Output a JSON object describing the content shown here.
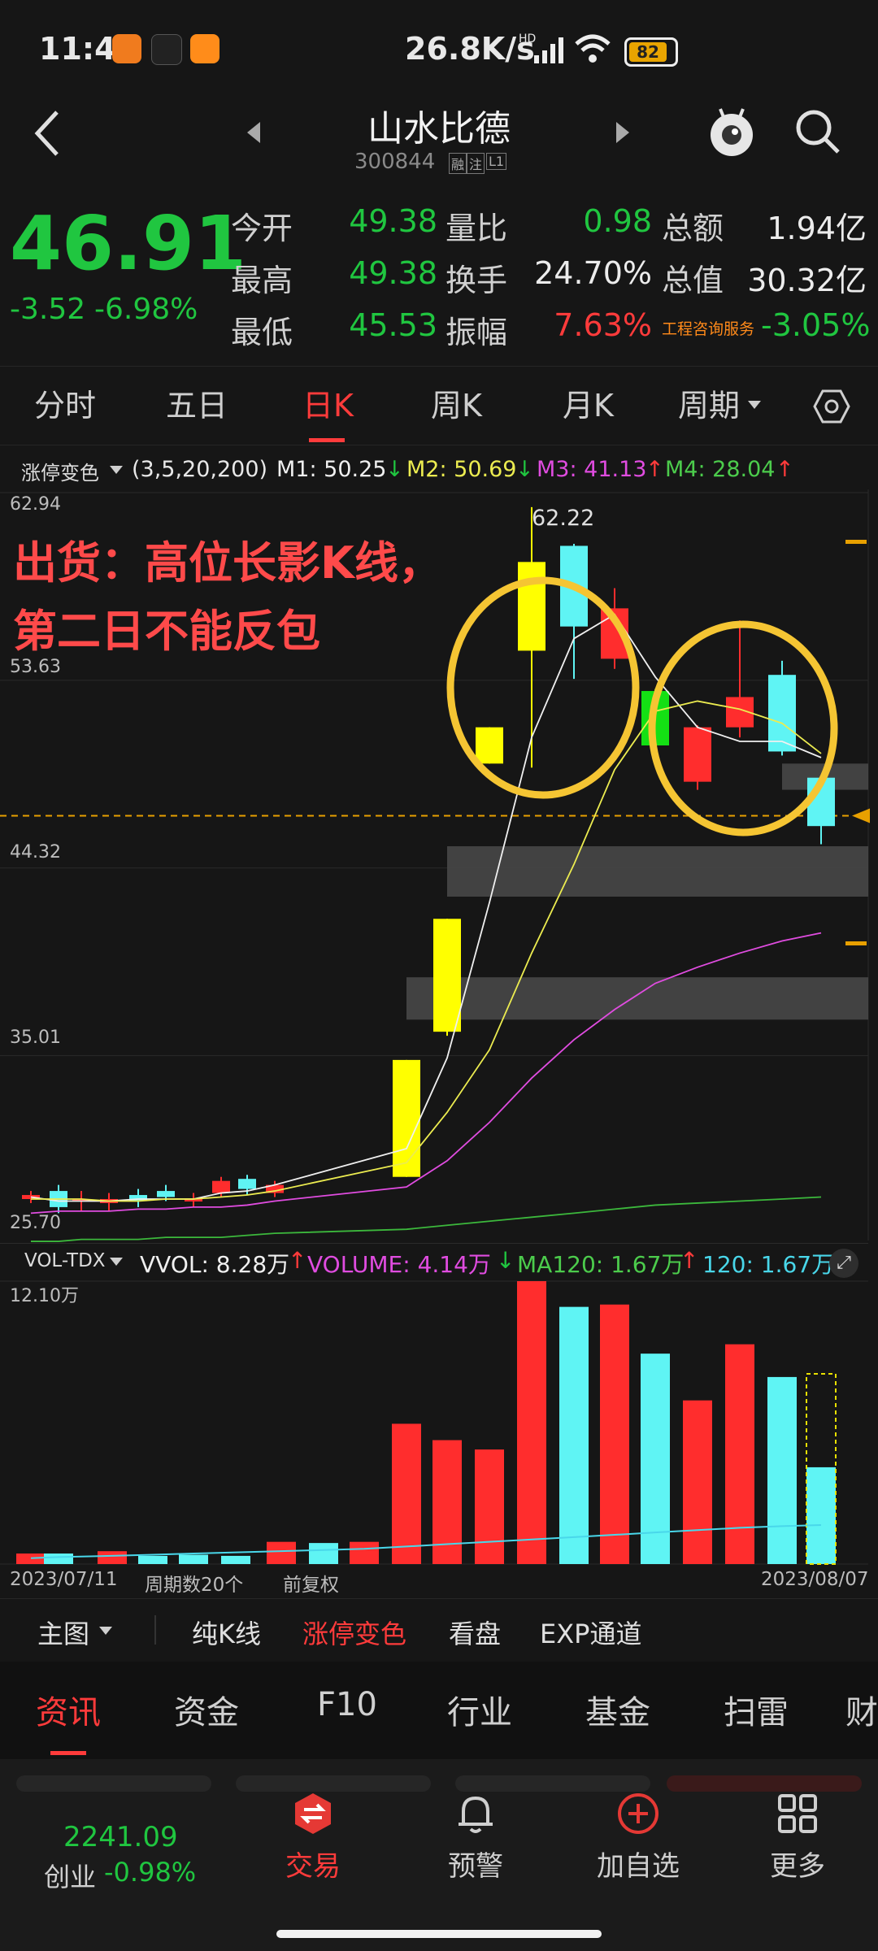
{
  "status": {
    "time": "11:41",
    "speed": "26.8K/s",
    "net": "HD",
    "battery": "82"
  },
  "header": {
    "title": "山水比德",
    "code": "300844",
    "badges": [
      "融",
      "注",
      "L1"
    ]
  },
  "quote": {
    "price": "46.91",
    "change": "-3.52",
    "change_pct": "-6.98%",
    "fields": [
      {
        "label": "今开",
        "value": "49.38",
        "color": "#20c640"
      },
      {
        "label": "最高",
        "value": "49.38",
        "color": "#20c640"
      },
      {
        "label": "最低",
        "value": "45.53",
        "color": "#20c640"
      },
      {
        "label": "量比",
        "value": "0.98",
        "color": "#20c640"
      },
      {
        "label": "换手",
        "value": "24.70%",
        "color": "#ececec"
      },
      {
        "label": "振幅",
        "value": "7.63%",
        "color": "#ff3b3b"
      },
      {
        "label": "总额",
        "value": "1.94亿",
        "color": "#ececec"
      },
      {
        "label": "总值",
        "value": "30.32亿",
        "color": "#ececec"
      },
      {
        "label": "工程咨询服务",
        "value": "-3.05%",
        "color": "#20c640"
      }
    ]
  },
  "tabs": [
    "分时",
    "五日",
    "日K",
    "周K",
    "月K",
    "周期"
  ],
  "active_tab": "日K",
  "indicator": {
    "mode": "涨停变色",
    "params": "(3,5,20,200)",
    "m1": "M1: 50.25",
    "m2": "M2: 50.69",
    "m3": "M3: 41.13",
    "m4": "M4: 28.04"
  },
  "annotation": {
    "line1": "出货：高位长影K线，",
    "line2": "第二日不能反包"
  },
  "price_axis": {
    "top": "62.94",
    "high_label": "62.22",
    "ticks": [
      "53.63",
      "44.32",
      "35.01",
      "25.70"
    ]
  },
  "candles": [
    {
      "o": 27.9,
      "c": 28.1,
      "h": 28.3,
      "l": 27.7,
      "color": "red"
    },
    {
      "o": 28.3,
      "c": 27.5,
      "h": 28.6,
      "l": 27.2,
      "color": "cyan"
    },
    {
      "o": 27.9,
      "c": 27.8,
      "h": 28.3,
      "l": 27.3,
      "color": "red"
    },
    {
      "o": 27.7,
      "c": 27.9,
      "h": 28.2,
      "l": 27.3,
      "color": "red"
    },
    {
      "o": 28.1,
      "c": 27.8,
      "h": 28.4,
      "l": 27.5,
      "color": "cyan"
    },
    {
      "o": 28.3,
      "c": 28.0,
      "h": 28.6,
      "l": 27.8,
      "color": "cyan"
    },
    {
      "o": 27.8,
      "c": 27.9,
      "h": 28.2,
      "l": 27.5,
      "color": "red"
    },
    {
      "o": 28.2,
      "c": 28.8,
      "h": 29.0,
      "l": 28.0,
      "color": "red"
    },
    {
      "o": 28.9,
      "c": 28.4,
      "h": 29.1,
      "l": 28.1,
      "color": "cyan"
    },
    {
      "o": 28.2,
      "c": 28.6,
      "h": 28.8,
      "l": 28.0,
      "color": "red"
    },
    {
      "o": 29.0,
      "c": 34.8,
      "h": 34.8,
      "l": 29.0,
      "color": "yellow"
    },
    {
      "o": 36.2,
      "c": 41.8,
      "h": 41.8,
      "l": 36.0,
      "color": "yellow"
    },
    {
      "o": 49.5,
      "c": 51.3,
      "h": 51.3,
      "l": 49.5,
      "color": "yellow"
    },
    {
      "o": 55.1,
      "c": 59.5,
      "h": 62.22,
      "l": 49.3,
      "color": "yellow"
    },
    {
      "o": 60.3,
      "c": 56.3,
      "h": 60.4,
      "l": 53.7,
      "color": "cyan"
    },
    {
      "o": 57.2,
      "c": 54.7,
      "h": 58.2,
      "l": 54.2,
      "color": "red"
    },
    {
      "o": 53.1,
      "c": 50.4,
      "h": 53.2,
      "l": 50.0,
      "color": "green"
    },
    {
      "o": 51.3,
      "c": 48.6,
      "h": 51.4,
      "l": 48.2,
      "color": "red"
    },
    {
      "o": 51.3,
      "c": 52.8,
      "h": 56.6,
      "l": 50.8,
      "color": "red"
    },
    {
      "o": 53.9,
      "c": 50.1,
      "h": 54.6,
      "l": 49.9,
      "color": "cyan"
    },
    {
      "o": 48.8,
      "c": 46.4,
      "h": 48.8,
      "l": 45.5,
      "color": "cyan"
    }
  ],
  "ma": {
    "white": [
      28.0,
      27.8,
      27.8,
      27.8,
      27.9,
      27.9,
      27.9,
      28.2,
      28.3,
      28.6,
      30.4,
      34.9,
      42.6,
      50.8,
      55.7,
      56.9,
      53.8,
      51.3,
      50.6,
      50.6,
      49.8
    ],
    "yellow": [
      27.9,
      27.9,
      27.9,
      27.8,
      27.8,
      27.9,
      27.9,
      28.0,
      28.1,
      28.3,
      29.7,
      32.2,
      35.3,
      40.1,
      44.5,
      49.2,
      52.1,
      52.6,
      52.2,
      51.5,
      50.0
    ],
    "magenta": [
      27.2,
      27.3,
      27.3,
      27.3,
      27.4,
      27.4,
      27.5,
      27.5,
      27.6,
      27.8,
      28.5,
      29.8,
      31.7,
      33.9,
      35.8,
      37.3,
      38.6,
      39.4,
      40.1,
      40.7,
      41.1
    ],
    "green": [
      25.8,
      25.8,
      25.9,
      25.9,
      25.9,
      26.0,
      26.0,
      26.0,
      26.1,
      26.2,
      26.4,
      26.6,
      26.8,
      27.0,
      27.2,
      27.4,
      27.6,
      27.7,
      27.8,
      27.9,
      28.0
    ]
  },
  "volume": {
    "header": {
      "mode": "VOL-TDX",
      "vvol": "VVOL: 8.28万",
      "volume": "VOLUME: 4.14万",
      "ma120": "MA120: 1.67万",
      "v120": "120: 1.67万"
    },
    "axis_top": "12.10万",
    "values": [
      0.45,
      0.45,
      0.55,
      0.35,
      0.4,
      0.35,
      0.95,
      0.9,
      0.95,
      6.0,
      5.3,
      4.9,
      12.6,
      11.0,
      11.1,
      9.0,
      7.0,
      9.4,
      8.0,
      4.14
    ],
    "colors": [
      "red",
      "cyan",
      "red",
      "cyan",
      "cyan",
      "cyan",
      "red",
      "cyan",
      "red",
      "red",
      "red",
      "red",
      "red",
      "cyan",
      "red",
      "cyan",
      "red",
      "red",
      "cyan",
      "cyan"
    ],
    "ma_line": [
      0.25,
      0.3,
      0.35,
      0.4,
      0.45,
      0.5,
      0.55,
      0.6,
      0.65,
      0.75,
      0.85,
      0.95,
      1.05,
      1.15,
      1.25,
      1.35,
      1.45,
      1.55,
      1.62,
      1.67
    ],
    "date_start": "2023/07/11",
    "period_count": "周期数20个",
    "adjust": "前复权",
    "date_end": "2023/08/07"
  },
  "tools": [
    "主图",
    "纯K线",
    "涨停变色",
    "看盘",
    "EXP通道"
  ],
  "active_tool": "涨停变色",
  "info_tabs": [
    "资讯",
    "资金",
    "F10",
    "行业",
    "基金",
    "扫雷",
    "财"
  ],
  "active_info_tab": "资讯",
  "nav": {
    "index_value": "2241.09",
    "index_name": "创业",
    "index_change": "-0.98%",
    "items": [
      "交易",
      "预警",
      "加自选",
      "更多"
    ]
  }
}
